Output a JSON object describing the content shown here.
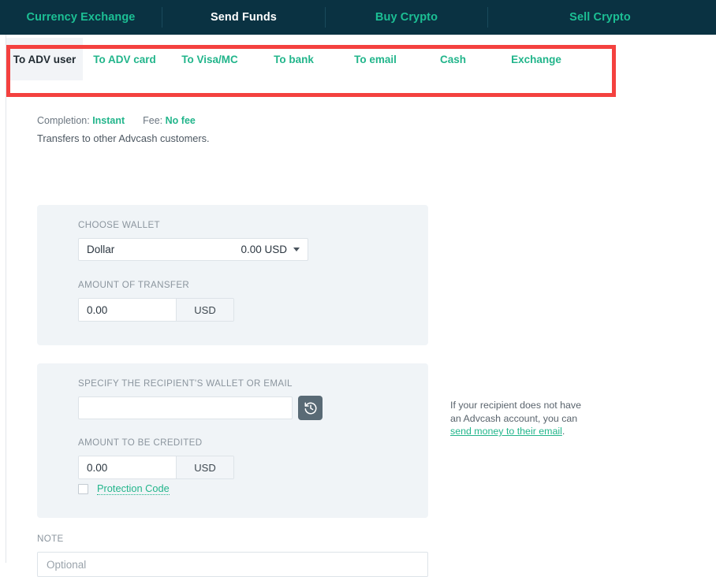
{
  "topnav": {
    "items": [
      {
        "label": "Currency Exchange",
        "active": false
      },
      {
        "label": "Send Funds",
        "active": true
      },
      {
        "label": "Buy Crypto",
        "active": false
      },
      {
        "label": "Sell Crypto",
        "active": false
      }
    ],
    "background_color": "#0a3242",
    "link_color": "#1cbf94",
    "active_color": "#ffffff"
  },
  "tabs": {
    "items": [
      {
        "label": "To ADV user",
        "active": true
      },
      {
        "label": "To ADV card",
        "active": false
      },
      {
        "label": "To Visa/MC",
        "active": false
      },
      {
        "label": "To bank",
        "active": false
      },
      {
        "label": "To email",
        "active": false
      },
      {
        "label": "Cash",
        "active": false
      },
      {
        "label": "Exchange",
        "active": false
      }
    ],
    "highlight_color": "#f4413f"
  },
  "info": {
    "completion_label": "Completion:",
    "completion_value": "Instant",
    "fee_label": "Fee:",
    "fee_value": "No fee",
    "description": "Transfers to other Advcash customers."
  },
  "form": {
    "wallet": {
      "label": "CHOOSE WALLET",
      "name": "Dollar",
      "balance": "0.00 USD"
    },
    "amount_of_transfer": {
      "label": "AMOUNT OF TRANSFER",
      "value": "0.00",
      "currency": "USD"
    },
    "recipient": {
      "label": "SPECIFY THE RECIPIENT'S WALLET OR EMAIL",
      "value": "",
      "placeholder": "",
      "history_icon": "history-icon"
    },
    "amount_to_be_credited": {
      "label": "AMOUNT TO BE CREDITED",
      "value": "0.00",
      "currency": "USD"
    },
    "protection_code": {
      "label": "Protection Code",
      "checked": false
    },
    "note": {
      "label": "NOTE",
      "value": "",
      "placeholder": "Optional"
    }
  },
  "helper": {
    "text_before": "If your recipient does not have an Advcash account, you can ",
    "link_text": "send money to their email",
    "text_after": "."
  }
}
